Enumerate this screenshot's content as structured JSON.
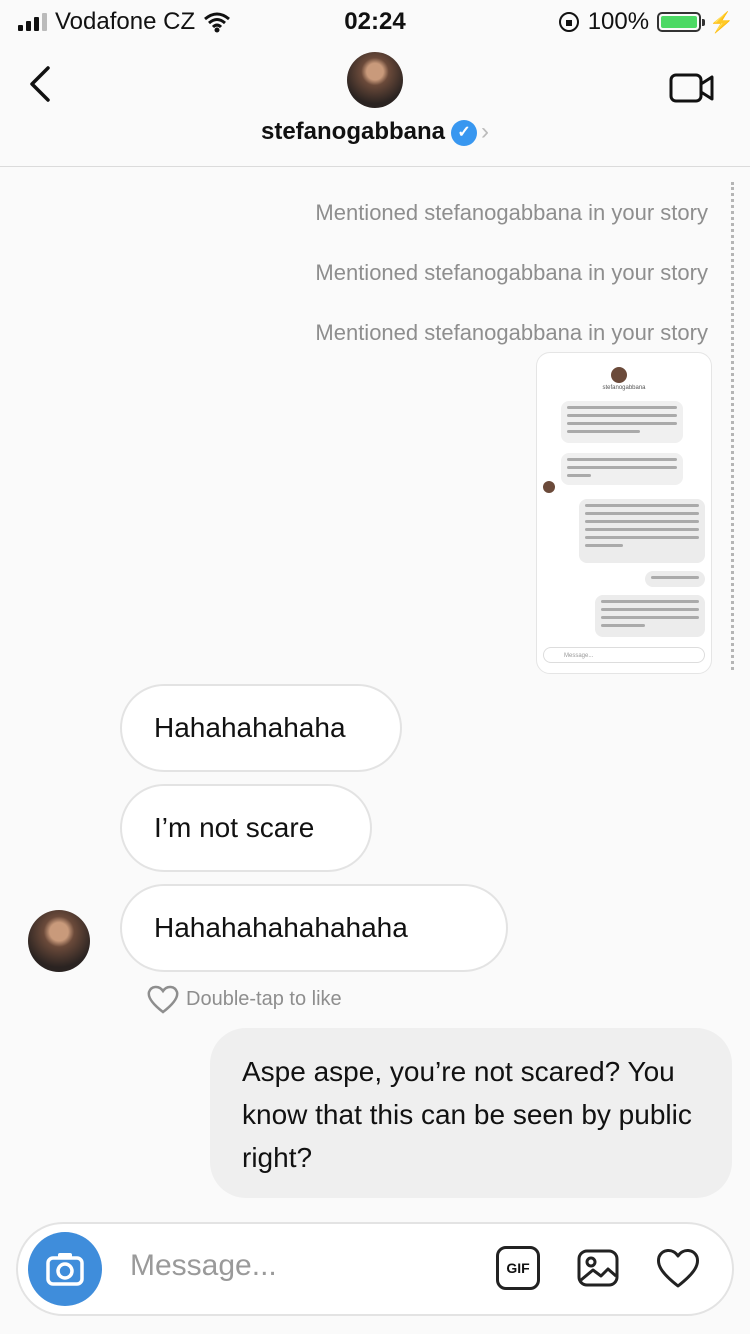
{
  "status_bar": {
    "carrier": "Vodafone CZ",
    "time": "02:24",
    "battery": "100%"
  },
  "header": {
    "username": "stefanogabbana",
    "verified": true,
    "icon_back": "chevron-left-icon",
    "icon_video": "video-call-icon"
  },
  "mentions": [
    "Mentioned stefanogabbana in your story",
    "Mentioned stefanogabbana in your story",
    "Mentioned stefanogabbana in your story"
  ],
  "story_preview": {
    "name": "stefanogabbana",
    "messages": [
      "All the worldwide know your attitude for example with the dogs!! So at this point you are more racist then our",
      "We celebrate the dogs we can not eat but we love and we live with",
      "First of all, it's have to see this way then to answer me, I think you're stupid. I wonder who has been deleted from your other Chinese social media in the first place",
      "Alora Stefano?",
      "And congratulations, I think you've just answered my question if you're a racist yourself"
    ],
    "composer_placeholder": "Message..."
  },
  "conversation": {
    "incoming": [
      "Hahahahahaha",
      "I’m not scare",
      "Hahahahahahahaha"
    ],
    "like_hint": "Double-tap to like",
    "outgoing": "Aspe aspe, you’re not scared? You know that this can be seen by public right?"
  },
  "composer": {
    "placeholder": "Message...",
    "gif_label": "GIF"
  },
  "colors": {
    "accent": "#3897f0",
    "camera": "#3f8ddb",
    "battery": "#4cd964"
  }
}
